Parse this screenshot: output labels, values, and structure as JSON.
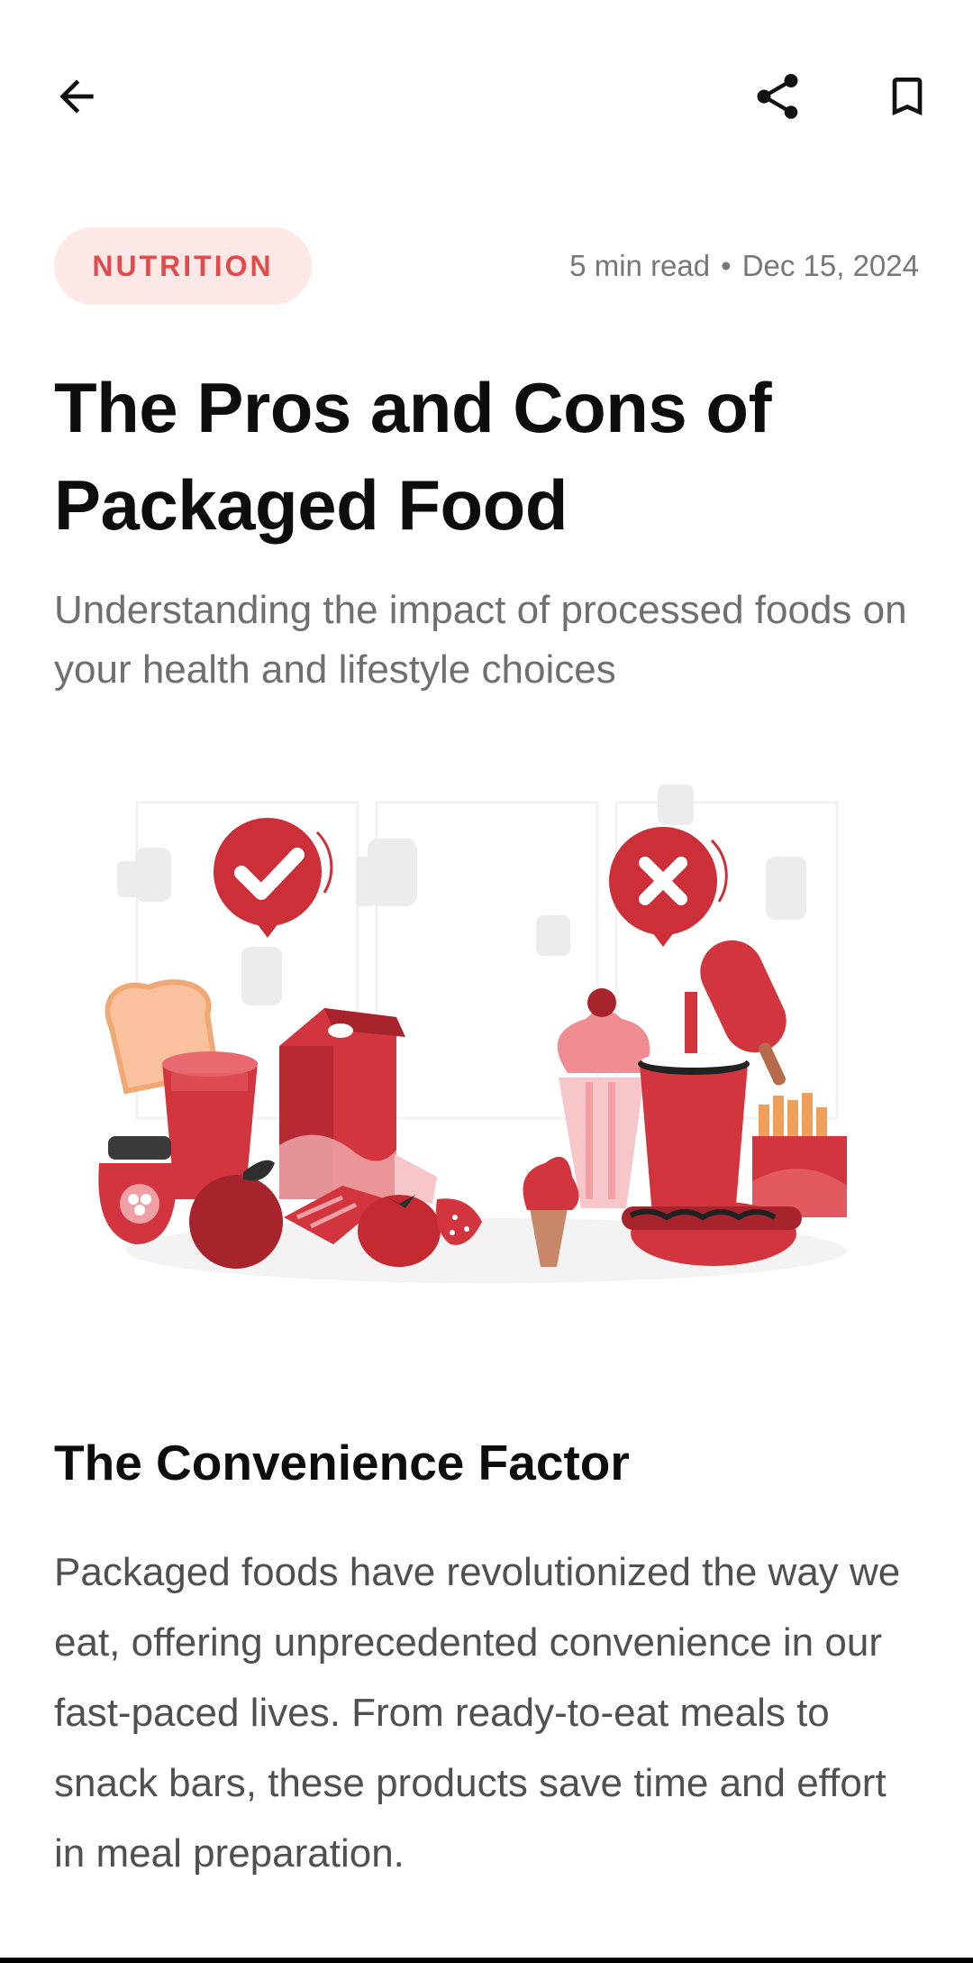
{
  "toolbar": {
    "back_icon": "arrow-left-icon",
    "share_icon": "share-icon",
    "bookmark_icon": "bookmark-icon"
  },
  "article": {
    "category": "NUTRITION",
    "read_time": "5 min read",
    "separator": "•",
    "date": "Dec 15, 2024",
    "title": "The Pros and Cons of Packaged Food",
    "subtitle": "Understanding the impact of processed foods on your health and lifestyle choices",
    "illustration": "packaged-food-pros-cons-illustration",
    "section_title": "The Convenience Factor",
    "section_body": "Packaged foods have revolutionized the way we eat, offering unprecedented convenience in our fast-paced lives. From ready-to-eat meals to snack bars, these products save time and effort in meal preparation."
  },
  "colors": {
    "accent": "#e24b4b",
    "chip_bg": "#fde8e8",
    "dark_red": "#a8242c",
    "mid_red": "#d2353e",
    "light_red": "#f0a0a4"
  }
}
